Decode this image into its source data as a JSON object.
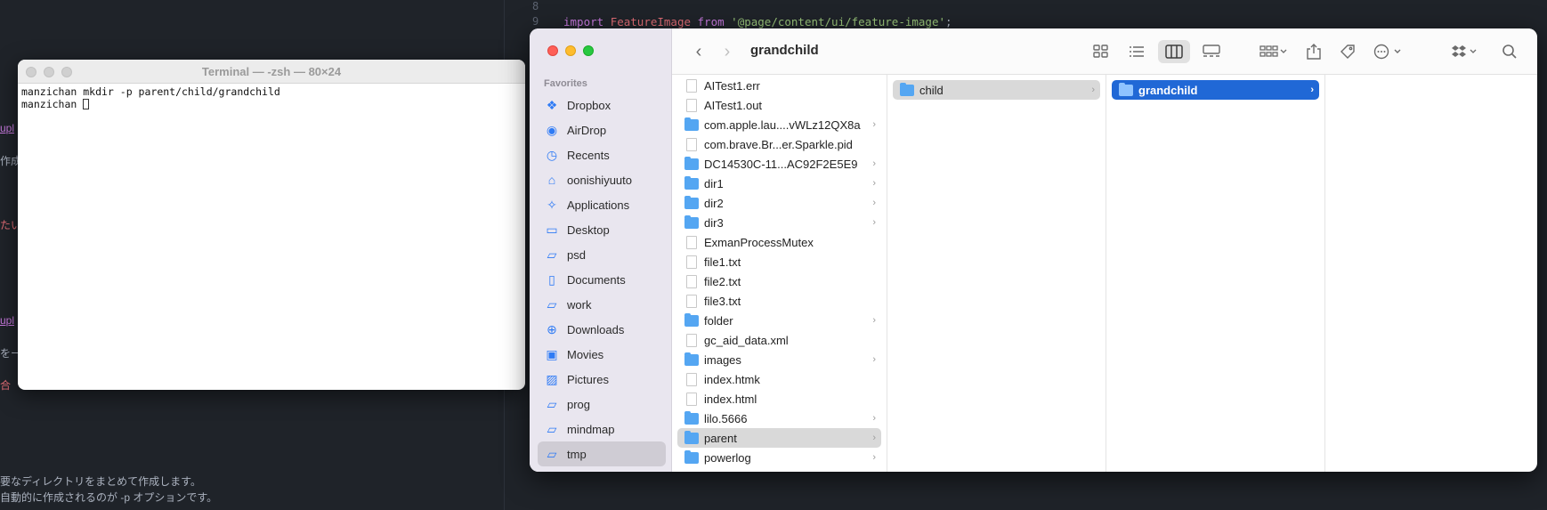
{
  "editor": {
    "line_numbers": [
      "8",
      "9"
    ],
    "import_keyword": "import",
    "import_name": "FeatureImage",
    "from_keyword": "from",
    "import_path": "'@page/content/ui/feature-image'",
    "semicolon": ";",
    "left_fragments": [
      "upl",
      "作成",
      "たい",
      "upl",
      "をー",
      "合"
    ],
    "bottom_line_1": "要なディレクトリをまとめて作成します。",
    "bottom_line_2": "自動的に作成されるのが -p オプションです。"
  },
  "terminal": {
    "title": "Terminal — -zsh — 80×24",
    "lines": [
      "manzichan mkdir -p parent/child/grandchild",
      "manzichan "
    ]
  },
  "finder": {
    "title": "grandchild",
    "favorites_heading": "Favorites",
    "sidebar": [
      {
        "label": "Dropbox",
        "icon": "dropbox-icon",
        "glyph": "❖"
      },
      {
        "label": "AirDrop",
        "icon": "airdrop-icon",
        "glyph": "◉"
      },
      {
        "label": "Recents",
        "icon": "clock-icon",
        "glyph": "◷"
      },
      {
        "label": "oonishiyuuto",
        "icon": "home-icon",
        "glyph": "⌂"
      },
      {
        "label": "Applications",
        "icon": "applications-icon",
        "glyph": "✧"
      },
      {
        "label": "Desktop",
        "icon": "desktop-icon",
        "glyph": "▭"
      },
      {
        "label": "psd",
        "icon": "folder-icon",
        "glyph": "▱"
      },
      {
        "label": "Documents",
        "icon": "document-icon",
        "glyph": "▯"
      },
      {
        "label": "work",
        "icon": "folder-icon",
        "glyph": "▱"
      },
      {
        "label": "Downloads",
        "icon": "download-icon",
        "glyph": "⊕"
      },
      {
        "label": "Movies",
        "icon": "movies-icon",
        "glyph": "▣"
      },
      {
        "label": "Pictures",
        "icon": "pictures-icon",
        "glyph": "▨"
      },
      {
        "label": "prog",
        "icon": "folder-icon",
        "glyph": "▱"
      },
      {
        "label": "mindmap",
        "icon": "folder-icon",
        "glyph": "▱"
      },
      {
        "label": "tmp",
        "icon": "folder-icon",
        "glyph": "▱",
        "selected": true
      }
    ],
    "column1": [
      {
        "name": "AITest1.err",
        "kind": "file"
      },
      {
        "name": "AITest1.out",
        "kind": "file"
      },
      {
        "name": "com.apple.lau....vWLz12QX8a",
        "kind": "folder"
      },
      {
        "name": "com.brave.Br...er.Sparkle.pid",
        "kind": "file"
      },
      {
        "name": "DC14530C-11...AC92F2E5E9",
        "kind": "folder"
      },
      {
        "name": "dir1",
        "kind": "folder"
      },
      {
        "name": "dir2",
        "kind": "folder"
      },
      {
        "name": "dir3",
        "kind": "folder"
      },
      {
        "name": "ExmanProcessMutex",
        "kind": "file"
      },
      {
        "name": "file1.txt",
        "kind": "file"
      },
      {
        "name": "file2.txt",
        "kind": "file"
      },
      {
        "name": "file3.txt",
        "kind": "file"
      },
      {
        "name": "folder",
        "kind": "folder"
      },
      {
        "name": "gc_aid_data.xml",
        "kind": "file"
      },
      {
        "name": "images",
        "kind": "folder"
      },
      {
        "name": "index.htmk",
        "kind": "file"
      },
      {
        "name": "index.html",
        "kind": "file"
      },
      {
        "name": "lilo.5666",
        "kind": "folder"
      },
      {
        "name": "parent",
        "kind": "folder",
        "selected": true
      },
      {
        "name": "powerlog",
        "kind": "folder"
      }
    ],
    "column2": [
      {
        "name": "child",
        "kind": "folder"
      }
    ],
    "column3": [
      {
        "name": "grandchild",
        "kind": "folder"
      }
    ]
  }
}
